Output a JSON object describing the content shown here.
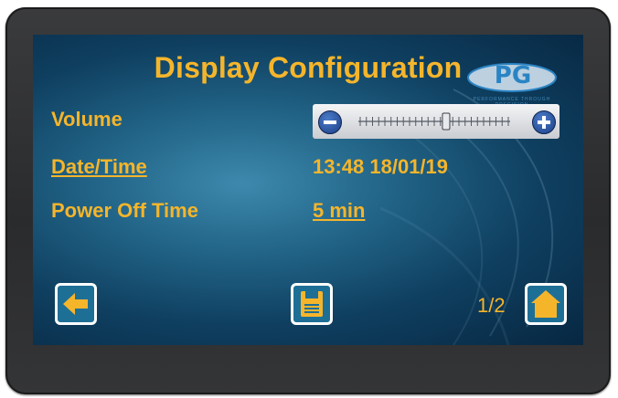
{
  "screen": {
    "title": "Display Configuration",
    "logo": {
      "text": "PG",
      "tagline": "PERFORMANCE THROUGH PRECISION"
    }
  },
  "settings": {
    "volume": {
      "label": "Volume",
      "level": 0.58,
      "minus_icon": "minus-icon",
      "plus_icon": "plus-icon"
    },
    "datetime": {
      "label": "Date/Time",
      "value": "13:48 18/01/19"
    },
    "power_off": {
      "label": "Power Off Time",
      "value": "5 min"
    }
  },
  "footer": {
    "back_icon": "arrow-left-icon",
    "save_icon": "floppy-disk-icon",
    "home_icon": "home-icon",
    "page_indicator": "1/2"
  },
  "colors": {
    "accent": "#f5b52b",
    "button_fill": "#1e6f96",
    "screen_dark": "#072741",
    "screen_light": "#3d89ad"
  }
}
